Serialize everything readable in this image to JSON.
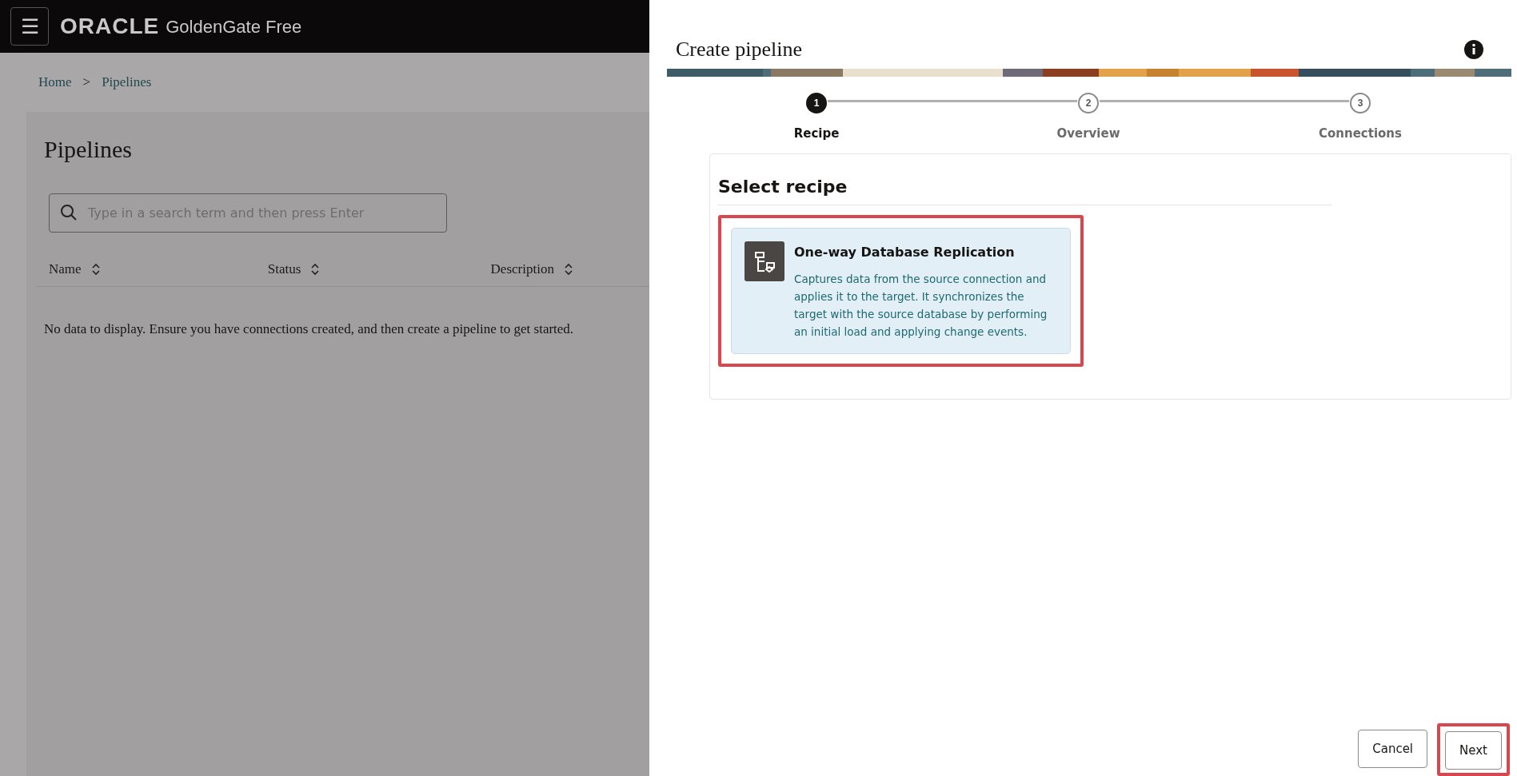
{
  "header": {
    "menu_icon": "☰",
    "brand": "ORACLE",
    "product": "GoldenGate Free"
  },
  "breadcrumb": [
    {
      "label": "Home"
    },
    {
      "label": "Pipelines"
    }
  ],
  "breadcrumb_separator": ">",
  "page": {
    "title": "Pipelines",
    "search": {
      "placeholder": "Type in a search term and then press Enter"
    },
    "table": {
      "columns": [
        {
          "label": "Name"
        },
        {
          "label": "Status"
        },
        {
          "label": "Description"
        }
      ],
      "empty_message": "No data to display. Ensure you have connections created, and then create a pipeline to get started."
    }
  },
  "panel": {
    "title": "Create pipeline",
    "steps": [
      {
        "number": "1",
        "label": "Recipe",
        "selected": true
      },
      {
        "number": "2",
        "label": "Overview",
        "selected": false
      },
      {
        "number": "3",
        "label": "Connections",
        "selected": false
      }
    ],
    "section_title": "Select recipe",
    "recipes": [
      {
        "title": "One-way Database Replication",
        "description": "Captures data from the source connection and applies it to the target. It synchronizes the target with the source database by performing an initial load and applying change events.",
        "selected": true,
        "highlighted": true
      }
    ],
    "buttons": [
      {
        "label": "Cancel",
        "highlighted": false
      },
      {
        "label": "Next",
        "highlighted": true
      }
    ]
  }
}
